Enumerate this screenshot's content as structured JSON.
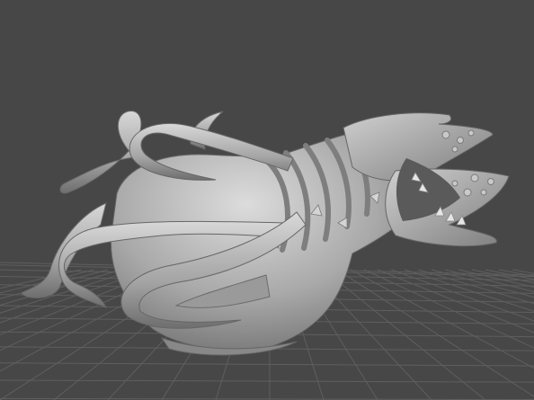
{
  "viewport": {
    "background_color": "#474747",
    "grid_color": "#5f5f5f",
    "model_color": "#a9a9a9",
    "model_shadow_color": "#6c6c6c",
    "model_highlight_color": "#e2e2e2",
    "model_subject": "tentacled-creature-sculpt"
  }
}
